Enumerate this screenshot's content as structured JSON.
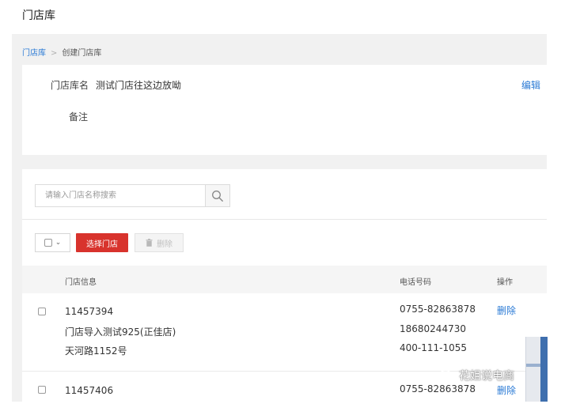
{
  "page": {
    "title": "门店库"
  },
  "breadcrumb": {
    "root": "门店库",
    "separator": ">",
    "current": "创建门店库"
  },
  "library_info": {
    "name_label": "门店库名",
    "name_value": "测试门店往这边放呦",
    "edit_label": "编辑",
    "remark_label": "备注"
  },
  "search": {
    "placeholder": "请输入门店名称搜索",
    "value": ""
  },
  "actions": {
    "select_store": "选择门店",
    "delete": "删除"
  },
  "table": {
    "headers": {
      "store_info": "门店信息",
      "phone": "电话号码",
      "operation": "操作"
    },
    "rows": [
      {
        "id": "11457394",
        "name": "门店导入测试925(正佳店)",
        "address": "天河路1152号",
        "phones": [
          "0755-82863878",
          "18680244730",
          "400-111-1055"
        ],
        "op": "删除"
      },
      {
        "id": "11457406",
        "phones": [
          "0755-82863878"
        ],
        "op": "删除"
      }
    ]
  },
  "watermark": {
    "text": "花姐说电商",
    "icon": "wechat-icon"
  },
  "colors": {
    "accent_red": "#d8332d",
    "link_blue": "#2a7ad5"
  }
}
